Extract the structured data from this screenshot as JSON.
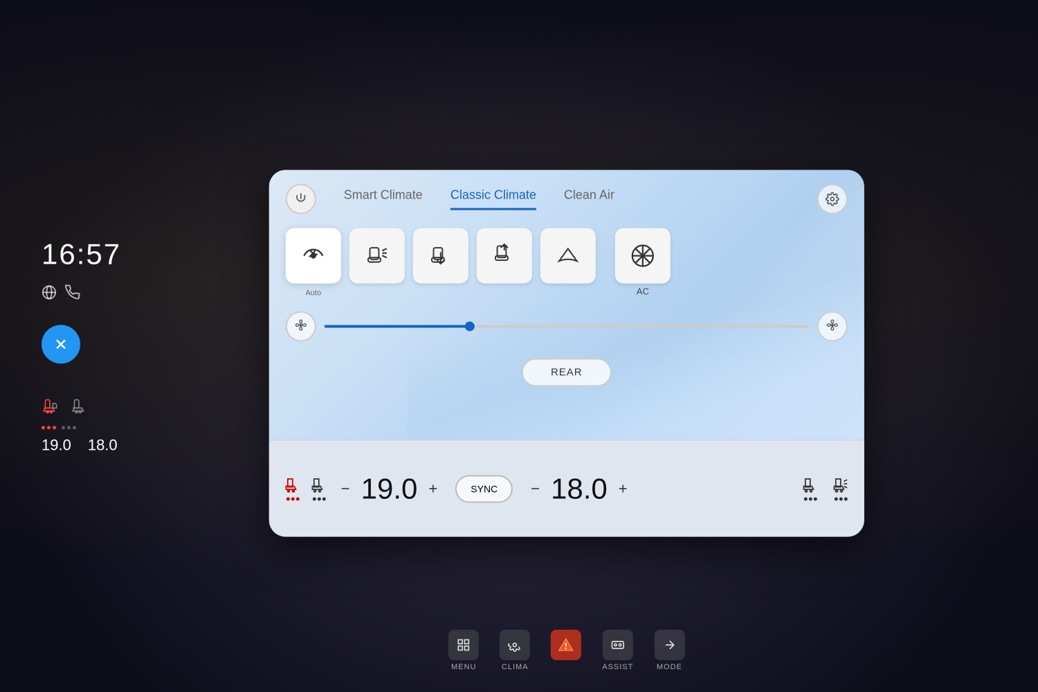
{
  "time": "16:57",
  "tabs": [
    {
      "label": "Smart Climate",
      "active": false
    },
    {
      "label": "Classic Climate",
      "active": true
    },
    {
      "label": "Clean Air",
      "active": false
    }
  ],
  "climate_buttons": [
    {
      "id": "auto",
      "label": "Auto",
      "active": true
    },
    {
      "id": "seat_heat_front",
      "label": "",
      "active": false
    },
    {
      "id": "airflow_down",
      "label": "",
      "active": false
    },
    {
      "id": "airflow_up",
      "label": "",
      "active": false
    },
    {
      "id": "windshield",
      "label": "",
      "active": false
    }
  ],
  "ac_label": "AC",
  "fan_speed_percent": 30,
  "rear_label": "REAR",
  "sync_label": "SYNC",
  "left_temp": "19.0",
  "right_temp": "18.0",
  "physical_buttons": [
    {
      "id": "menu",
      "label": "MENU"
    },
    {
      "id": "clima",
      "label": "CLIMA"
    },
    {
      "id": "hazard",
      "label": ""
    },
    {
      "id": "assist",
      "label": "ASSIST"
    },
    {
      "id": "mode",
      "label": "MODE"
    }
  ],
  "left_panel": {
    "time": "16:57",
    "left_temp": "19.0",
    "right_temp": "18.0"
  }
}
